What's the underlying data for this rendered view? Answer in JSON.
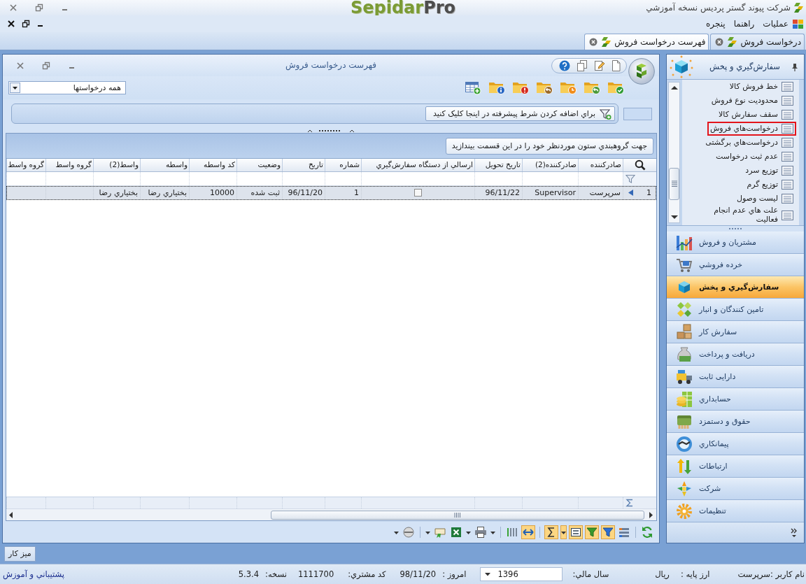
{
  "window": {
    "title": "شرکت پیوند گستر پردیس نسخه آموزشي",
    "logo": {
      "brand": "Sepidar",
      "suffix": "Pro"
    }
  },
  "menu": [
    "عمليات",
    "راهنما",
    "پنجره"
  ],
  "tabs": [
    {
      "label": "درخواست فروش",
      "selected": false
    },
    {
      "label": "فهرست درخواست فروش",
      "selected": true
    }
  ],
  "list_window": {
    "title": "فهرست درخواست فروش",
    "view_dropdown": {
      "value": "همه درخواستها"
    },
    "advanced_filter_button": "براي اضافه کردن شرط پيشرفته در اينجا کليک کنيد",
    "group_by_hint": "جهت گروهبندي ستون موردنظر خود را در اين قسمت بيندازيد",
    "table": {
      "columns": [
        "صادرکننده",
        "صادرکننده(2)",
        "تاريخ تحويل",
        "ارسالي از دستگاه سفارش‌گيري",
        "شماره",
        "تاريخ",
        "وضعيت",
        "کد واسطه",
        "واسطه",
        "واسط(2)",
        "گروه واسط",
        "گروه واسط"
      ],
      "rows": [
        {
          "number": "1",
          "selected": true,
          "cells": [
            {
              "kind": "text",
              "text": "سرپرست"
            },
            {
              "kind": "text",
              "text": "Supervisor"
            },
            {
              "kind": "text",
              "text": "96/11/22"
            },
            {
              "kind": "checkbox",
              "checked": false
            },
            {
              "kind": "text",
              "text": "1"
            },
            {
              "kind": "text",
              "text": "96/11/20"
            },
            {
              "kind": "text",
              "text": "ثبت شده"
            },
            {
              "kind": "text",
              "text": "10000"
            },
            {
              "kind": "text",
              "text": "بختياري رضا"
            },
            {
              "kind": "text",
              "text": "بختياري رضا"
            }
          ]
        }
      ]
    },
    "grid_toolbar": [
      {
        "pressed": false
      },
      {
        "pressed": false
      },
      {
        "pressed": true
      },
      {
        "pressed": true
      },
      {
        "pressed": true
      },
      {
        "pressed": true
      },
      {
        "pressed": true
      },
      {
        "pressed": true
      },
      {
        "pressed": false
      },
      {
        "pressed": false
      },
      {
        "pressed": false
      },
      {
        "pressed": false
      },
      {
        "pressed": false
      },
      {
        "pressed": false
      },
      {
        "pressed": false
      },
      {
        "pressed": false
      },
      {
        "pressed": false
      }
    ]
  },
  "sidebar": {
    "title": "سفارش‌گيري و پخش",
    "items": [
      {
        "label": "خط فروش کالا",
        "highlighted": false
      },
      {
        "label": "محدوديت نوع فروش",
        "highlighted": false
      },
      {
        "label": "سقف سفارش کالا",
        "highlighted": false
      },
      {
        "label": "درخواست‌هاي فروش",
        "highlighted": true
      },
      {
        "label": "درخواست‌هاي برگشتی",
        "highlighted": false
      },
      {
        "label": "عدم ثبت درخواست",
        "highlighted": false
      },
      {
        "label": "توزيع سرد",
        "highlighted": false
      },
      {
        "label": "توزيع گرم",
        "highlighted": false
      },
      {
        "label": "ليست وصول",
        "highlighted": false
      },
      {
        "label": "علت هاي عدم انجام فعاليت",
        "highlighted": false
      }
    ],
    "modules": [
      {
        "label": "مشتريان و فروش",
        "selected": false
      },
      {
        "label": "خرده فروشي",
        "selected": false
      },
      {
        "label": "سفارش‌گيري و پخش",
        "selected": true
      },
      {
        "label": "تامين کنندگان و انبار",
        "selected": false
      },
      {
        "label": "سفارش کار",
        "selected": false
      },
      {
        "label": "دريافت و پرداخت",
        "selected": false
      },
      {
        "label": "دارایی ثابت",
        "selected": false
      },
      {
        "label": "حسابداري",
        "selected": false
      },
      {
        "label": "حقوق و دستمزد",
        "selected": false
      },
      {
        "label": "پيمانکاري",
        "selected": false
      },
      {
        "label": "ارتباطات",
        "selected": false
      },
      {
        "label": "شرکت",
        "selected": false
      },
      {
        "label": "تنظيمات",
        "selected": false
      }
    ]
  },
  "desktop_button": "ميز کار",
  "status_bar": {
    "user": "نام کاربر :سرپرست",
    "currency_label": "ارز پایه :",
    "currency": "ريال",
    "fiscal_year_label": "سال مالي:",
    "fiscal_year": "1396",
    "today_label": "امروز :",
    "today": "98/11/20",
    "customer_code_label": "کد مشتري:",
    "customer_code": "1111700",
    "version_label": "نسخه:",
    "version": "5.3.4",
    "support_link": "پشتيباني و آموزش"
  }
}
